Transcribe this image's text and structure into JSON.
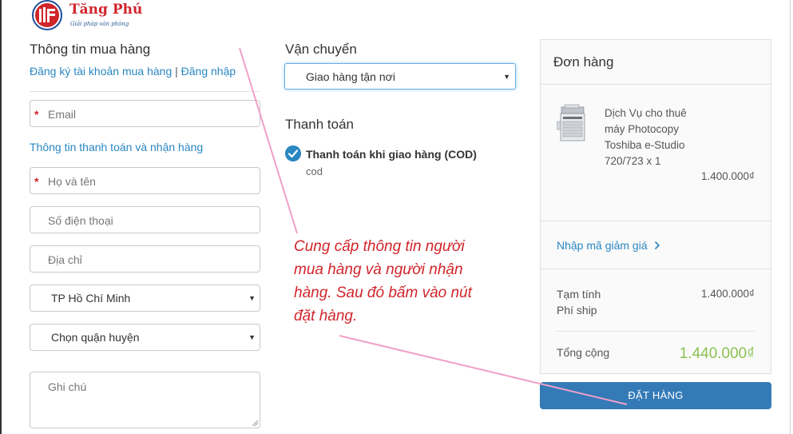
{
  "brand": {
    "name": "Tăng Phú",
    "tagline": "Giải pháp văn phòng"
  },
  "customer": {
    "title": "Thông tin mua hàng",
    "register_link": "Đăng ký tài khoản mua hàng",
    "separator": "|",
    "login_link": "Đăng nhập",
    "email_placeholder": "Email",
    "billing_link": "Thông tin thanh toán và nhận hàng",
    "name_placeholder": "Họ và tên",
    "phone_placeholder": "Số điện thoại",
    "address_placeholder": "Địa chỉ",
    "city_value": "TP Hồ Chí Minh",
    "district_value": "Chọn quận huyện",
    "note_placeholder": "Ghi chú",
    "required_mark": "*"
  },
  "shipping": {
    "title": "Vận chuyển",
    "method": "Giao hàng tận nơi"
  },
  "payment": {
    "title": "Thanh toán",
    "option_label": "Thanh toán khi giao hàng (COD)",
    "option_sub": "cod"
  },
  "order": {
    "title": "Đơn hàng",
    "product_name": "Dịch Vụ cho thuê máy Photocopy Toshiba e-Studio 720/723 x 1",
    "product_price": "1.400.000₫",
    "coupon_link": "Nhập mã giảm giá",
    "subtotal_label": "Tạm tính",
    "subtotal_value": "1.400.000₫",
    "shipping_label": "Phí ship",
    "total_label": "Tổng cộng",
    "total_value": "1.440.000₫",
    "submit_label": "ĐẶT HÀNG"
  },
  "annotation": {
    "text": "Cung cấp thông tin người mua hàng và người nhận hàng. Sau đó bấm vào nút đặt hàng."
  },
  "colors": {
    "accent": "#2a87c2",
    "button": "#337ab7",
    "total": "#8cc152",
    "annotation": "#d0252b",
    "arrow": "#f0a0c8"
  },
  "icons": {
    "logo": "tang-phu-logo-icon",
    "check": "check-circle-icon",
    "chevron": "chevron-right-icon",
    "caret": "caret-down-icon",
    "product": "photocopier-icon"
  }
}
